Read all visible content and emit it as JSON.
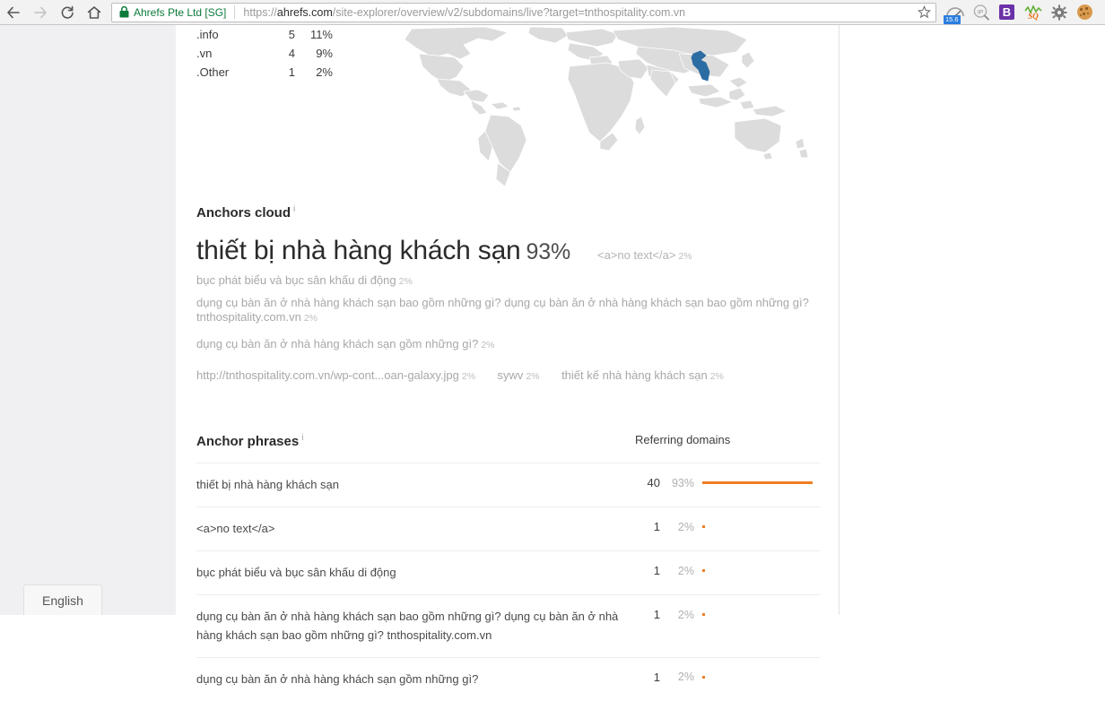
{
  "browser": {
    "back_icon": "arrow-left-icon",
    "forward_icon": "arrow-right-icon",
    "reload_icon": "reload-icon",
    "home_icon": "home-icon",
    "security_label": "Ahrefs Pte Ltd [SG]",
    "lock_icon": "lock-icon",
    "url_prefix": "https://",
    "url_domain": "ahrefs.com",
    "url_path": "/site-explorer/overview/v2/subdomains/live?target=tnthospitality.com.vn",
    "url_full": "https://ahrefs.com/site-explorer/overview/v2/subdomains/live?target=tnthospitality.com.vn",
    "bookmark_icon": "star-icon",
    "extensions": [
      {
        "name": "pagespeed-gauge-icon",
        "badge": "15.6"
      },
      {
        "name": "ip-lookup-icon",
        "badge": ""
      },
      {
        "name": "bootstrap-icon",
        "label": "B",
        "badge": ""
      },
      {
        "name": "seoquake-icon",
        "label": "SQ",
        "badge": ""
      },
      {
        "name": "gear-icon",
        "badge": ""
      },
      {
        "name": "cookie-icon",
        "badge": ""
      }
    ]
  },
  "tld_distribution": {
    "rows": [
      {
        "tld": ".info",
        "count": "5",
        "pct": "11%"
      },
      {
        "tld": ".vn",
        "count": "4",
        "pct": "9%"
      },
      {
        "tld": ".Other",
        "count": "1",
        "pct": "2%"
      }
    ]
  },
  "map": {
    "name": "world-map",
    "highlight_country": "Vietnam",
    "highlight_color": "#2b6ca3",
    "land_color": "#dcdcdc"
  },
  "anchors_cloud": {
    "title": "Anchors cloud",
    "info": "i",
    "primary": {
      "text": "thiết bị nhà hàng khách sạn",
      "pct": "93%"
    },
    "secondary": {
      "text": "<a>no text</a>",
      "pct": "2%"
    },
    "items": [
      {
        "text": "bục phát biểu và bục sân khấu di động",
        "pct": "2%"
      },
      {
        "text": "dụng cụ bàn ăn ở nhà hàng khách sạn bao gồm những gì? dụng cụ bàn ăn ở nhà hàng khách sạn bao gồm những gì? tnthospitality.com.vn",
        "pct": "2%"
      },
      {
        "text": "dụng cụ bàn ăn ở nhà hàng khách sạn gồm những gì?",
        "pct": "2%"
      }
    ],
    "inline_items": [
      {
        "text": "http://tnthospitality.com.vn/wp-cont...oan-galaxy.jpg",
        "pct": "2%"
      },
      {
        "text": "sywv",
        "pct": "2%"
      },
      {
        "text": "thiết kế nhà hàng khách sạn",
        "pct": "2%"
      }
    ]
  },
  "anchor_phrases": {
    "title": "Anchor phrases",
    "info": "i",
    "column_referring_domains": "Referring domains",
    "bar_color": "#ef7e22",
    "rows": [
      {
        "phrase": "thiết bị nhà hàng khách sạn",
        "count": "40",
        "pct": "93%",
        "bar_pct": 93
      },
      {
        "phrase": "<a>no text</a>",
        "count": "1",
        "pct": "2%",
        "bar_pct": 2
      },
      {
        "phrase": "bục phát biểu và bục sân khấu di động",
        "count": "1",
        "pct": "2%",
        "bar_pct": 2
      },
      {
        "phrase": "dụng cụ bàn ăn ở nhà hàng khách sạn bao gồm những gì? dụng cụ bàn ăn ở nhà hàng khách sạn bao gồm những gì? tnthospitality.com.vn",
        "count": "1",
        "pct": "2%",
        "bar_pct": 2
      },
      {
        "phrase": "dụng cụ bàn ăn ở nhà hàng khách sạn gồm những gì?",
        "count": "1",
        "pct": "2%",
        "bar_pct": 2
      }
    ]
  },
  "footer": {
    "language_label": "English"
  }
}
